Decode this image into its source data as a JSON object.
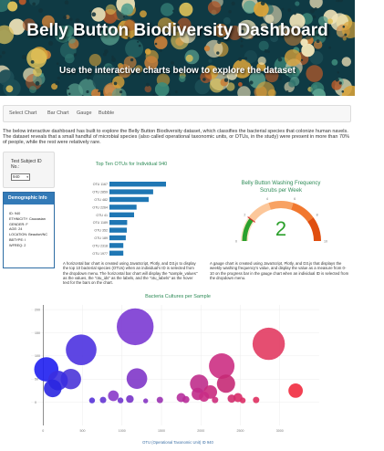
{
  "hero": {
    "title": "Belly Button Biodiversity Dashboard",
    "subtitle": "Use the interactive charts below to explore the dataset"
  },
  "nav": {
    "brand": "Select Chart",
    "items": [
      "Bar Chart",
      "Gauge",
      "Bubble"
    ]
  },
  "intro": "The below interactive dashboard has built to explore the Belly Button Biodiversity dataset, which classifies the bacterial species that colonize human navels. The dataset reveals that a small handful of microbial species (also called operational taxonomic units, or OTUs, in the study) were present in more than 70% of people, while the rest were relatively rare.",
  "select": {
    "label": "Test Subject ID No.:",
    "value": "940"
  },
  "demographic": {
    "title": "Demographic Info",
    "lines": [
      "ID: 940",
      "ETHNICITY: Caucasian",
      "GENDER: F",
      "AGE: 24",
      "LOCATION: Beaufort/NC",
      "BBTYPE: I",
      "WFREQ: 2"
    ]
  },
  "captions": {
    "bar": "A horizontal bar chart is created using JavaScript, Plotly, and D3.js to display the top 10 bacterial species (OTUs) when an individual's ID is selected from the dropdown menu. The horizontal bar chart will display the \"sample_values\" as the values, the \"otu_ids\" as the labels, and the \"otu_labels\" as the hover text for the bars on the chart.",
    "gauge": "A gauge chart is created using JavaScript, Plotly, and D3.js that displays the weekly washing frequency's value, and display the value as a measure from 0-10 on the progress bar in the gauge chart when an individual ID is selected from the dropdown menu."
  },
  "colors": {
    "primary": "#337ab7",
    "bar": "#1f77b4",
    "gauge_needle": "#2ca02c"
  },
  "chart_data": [
    {
      "type": "bar",
      "orientation": "horizontal",
      "title": "Top Ten OTUs for Individual 940",
      "categories": [
        "OTU 1167",
        "OTU 2859",
        "OTU 482",
        "OTU 2264",
        "OTU 41",
        "OTU 1189",
        "OTU 352",
        "OTU 189",
        "OTU 2318",
        "OTU 1977"
      ],
      "values": [
        163,
        126,
        113,
        78,
        71,
        51,
        50,
        47,
        40,
        40
      ]
    },
    {
      "type": "gauge",
      "title": "Belly Button Washing Frequency",
      "subtitle": "Scrubs per Week",
      "value": 2,
      "range": [
        0,
        10
      ],
      "tick_labels": [
        "0",
        "2",
        "4",
        "6",
        "8",
        "10"
      ],
      "bands": [
        {
          "from": 0,
          "to": 2,
          "color": "#fde4c4"
        },
        {
          "from": 2,
          "to": 4,
          "color": "#fcc79a"
        },
        {
          "from": 4,
          "to": 6,
          "color": "#f8a263"
        },
        {
          "from": 6,
          "to": 8,
          "color": "#f1782f"
        },
        {
          "from": 8,
          "to": 10,
          "color": "#e04f10"
        }
      ]
    },
    {
      "type": "scatter",
      "bubble": true,
      "title": "Bacteria Cultures per Sample",
      "xlabel": "OTU (Operational Taxonomic Unit) ID 940",
      "xticks": [
        "0",
        "500",
        "1000",
        "1500",
        "2000",
        "2500",
        "3000"
      ],
      "xlim": [
        -200,
        3500
      ],
      "yticks": [
        "0",
        "50",
        "100",
        "150",
        "200"
      ],
      "ylim": [
        -50,
        210
      ],
      "points": [
        {
          "x": 41,
          "y": 71,
          "size": 71,
          "color": "#1f1ff0"
        },
        {
          "x": 121,
          "y": 30,
          "size": 38,
          "color": "#2a26e0"
        },
        {
          "x": 189,
          "y": 47,
          "size": 47,
          "color": "#3a2de0"
        },
        {
          "x": 352,
          "y": 50,
          "size": 50,
          "color": "#4a35d8"
        },
        {
          "x": 482,
          "y": 113,
          "size": 113,
          "color": "#4d32e0"
        },
        {
          "x": 1167,
          "y": 163,
          "size": 163,
          "color": "#7b3ad3"
        },
        {
          "x": 1189,
          "y": 51,
          "size": 51,
          "color": "#7f36c9"
        },
        {
          "x": 1977,
          "y": 40,
          "size": 40,
          "color": "#bf2d8c"
        },
        {
          "x": 2264,
          "y": 78,
          "size": 78,
          "color": "#cc2f83"
        },
        {
          "x": 2318,
          "y": 40,
          "size": 40,
          "color": "#c52a75"
        },
        {
          "x": 2859,
          "y": 126,
          "size": 126,
          "color": "#e23b62"
        },
        {
          "x": 3200,
          "y": 25,
          "size": 25,
          "color": "#f12b3f"
        },
        {
          "x": 890,
          "y": 14,
          "size": 14,
          "color": "#8a3ac9"
        },
        {
          "x": 1100,
          "y": 7,
          "size": 7,
          "color": "#7733c8"
        },
        {
          "x": 1480,
          "y": 5,
          "size": 5,
          "color": "#9b33b3"
        },
        {
          "x": 1750,
          "y": 10,
          "size": 10,
          "color": "#b6309d"
        },
        {
          "x": 1810,
          "y": 6,
          "size": 6,
          "color": "#b82d99"
        },
        {
          "x": 1960,
          "y": 18,
          "size": 18,
          "color": "#c02c8a"
        },
        {
          "x": 2040,
          "y": 12,
          "size": 12,
          "color": "#c92c85"
        },
        {
          "x": 2120,
          "y": 22,
          "size": 22,
          "color": "#c92b7e"
        },
        {
          "x": 2180,
          "y": 5,
          "size": 5,
          "color": "#cd2d7c"
        },
        {
          "x": 2390,
          "y": 8,
          "size": 8,
          "color": "#d22d6e"
        },
        {
          "x": 2470,
          "y": 10,
          "size": 10,
          "color": "#d82e69"
        },
        {
          "x": 2530,
          "y": 4,
          "size": 4,
          "color": "#db2e66"
        },
        {
          "x": 2700,
          "y": 5,
          "size": 5,
          "color": "#df2f5f"
        },
        {
          "x": 620,
          "y": 4,
          "size": 4,
          "color": "#5733d8"
        },
        {
          "x": 760,
          "y": 5,
          "size": 5,
          "color": "#6435d2"
        },
        {
          "x": 980,
          "y": 4,
          "size": 4,
          "color": "#7035cd"
        },
        {
          "x": 1300,
          "y": 3,
          "size": 3,
          "color": "#8534c3"
        }
      ]
    }
  ]
}
